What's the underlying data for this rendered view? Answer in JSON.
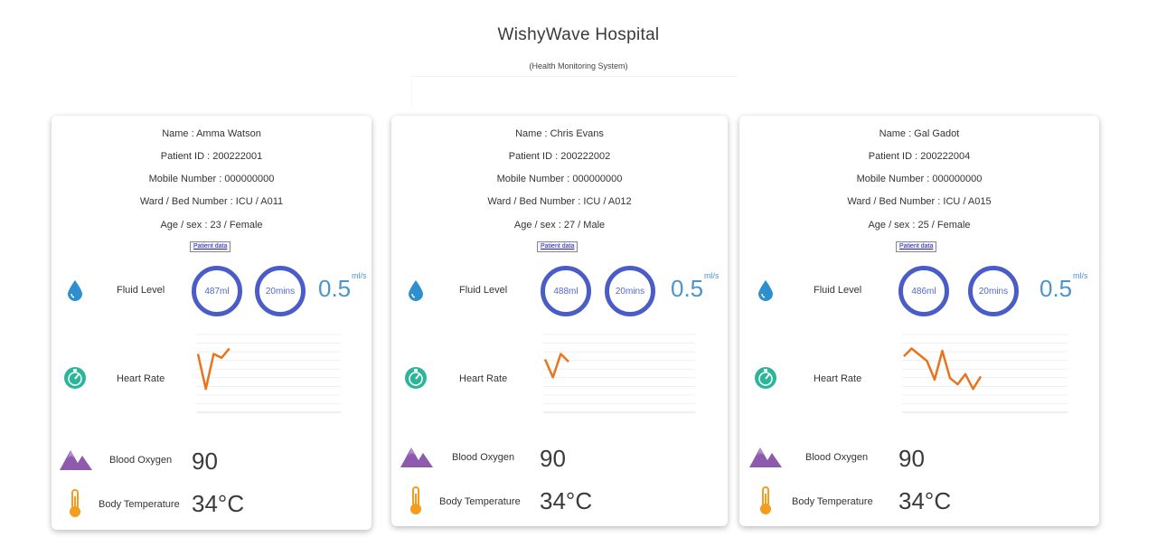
{
  "header": {
    "title": "WishyWave Hospital",
    "subtitle": "(Health Monitoring System)"
  },
  "labels": {
    "patient_data_button": "Patient data",
    "fluid_level": "Fluid Level",
    "heart_rate": "Heart Rate",
    "blood_oxygen": "Blood Oxygen",
    "body_temperature": "Body Temperature",
    "rate_unit": "ml/s"
  },
  "colors": {
    "ring": "#4a5cc7",
    "rate_text": "#4a95cf",
    "fluid_icon": "#2e8fd0",
    "heart_icon": "#2bb59a",
    "oxygen_icon": "#8e5aad",
    "temp_icon": "#f39c1e",
    "heart_line": "#e8741e"
  },
  "icons": {
    "fluid": "water-drop-icon",
    "heart": "speedometer-icon",
    "oxygen": "mountains-icon",
    "temperature": "thermometer-icon"
  },
  "patients": [
    {
      "name": "Name : Amma Watson",
      "patient_id": "Patient ID : 200222001",
      "mobile": "Mobile Number : 000000000",
      "ward": "Ward / Bed Number : ICU / A011",
      "age_sex": "Age / sex : 23 / Female",
      "fluid_volume": "487ml",
      "fluid_time": "20mins",
      "fluid_rate": "0.5",
      "blood_oxygen": "90",
      "body_temperature": "34°C",
      "heart_rate_series": [
        0.75,
        0.3,
        0.75,
        0.7,
        0.82
      ]
    },
    {
      "name": "Name : Chris Evans",
      "patient_id": "Patient ID : 200222002",
      "mobile": "Mobile Number : 000000000",
      "ward": "Ward / Bed Number : ICU / A012",
      "age_sex": "Age / sex : 27 / Male",
      "fluid_volume": "488ml",
      "fluid_time": "20mins",
      "fluid_rate": "0.5",
      "blood_oxygen": "90",
      "body_temperature": "34°C",
      "heart_rate_series": [
        0.68,
        0.45,
        0.75,
        0.65
      ]
    },
    {
      "name": "Name : Gal Gadot",
      "patient_id": "Patient ID : 200222004",
      "mobile": "Mobile Number : 000000000",
      "ward": "Ward / Bed Number : ICU / A015",
      "age_sex": "Age / sex : 25 / Female",
      "fluid_volume": "486ml",
      "fluid_time": "20mins",
      "fluid_rate": "0.5",
      "blood_oxygen": "90",
      "body_temperature": "34°C",
      "heart_rate_series": [
        0.72,
        0.82,
        0.74,
        0.66,
        0.42,
        0.79,
        0.44,
        0.36,
        0.49,
        0.3,
        0.46
      ]
    }
  ]
}
